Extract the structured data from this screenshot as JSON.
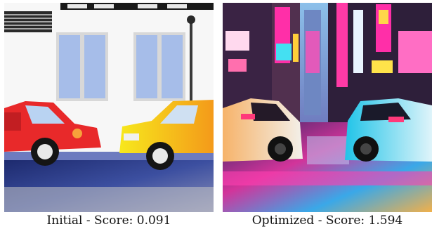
{
  "panels": [
    {
      "caption": "Initial - Score: 0.091",
      "colors": {
        "wall": "#f7f7f7",
        "window": "#9fb8e8",
        "left_car": "#e8292a",
        "right_car": "#f4e01a",
        "road": "#2d3a78"
      }
    },
    {
      "caption": "Optimized - Score: 1.594",
      "colors": {
        "sky": "#7fb6e0",
        "neon_pink": "#ff2fa8",
        "neon_cyan": "#22d8f0",
        "left_car": "#f2a35a",
        "right_car": "#36d0e6",
        "street": "#3b2a6a"
      }
    }
  ]
}
